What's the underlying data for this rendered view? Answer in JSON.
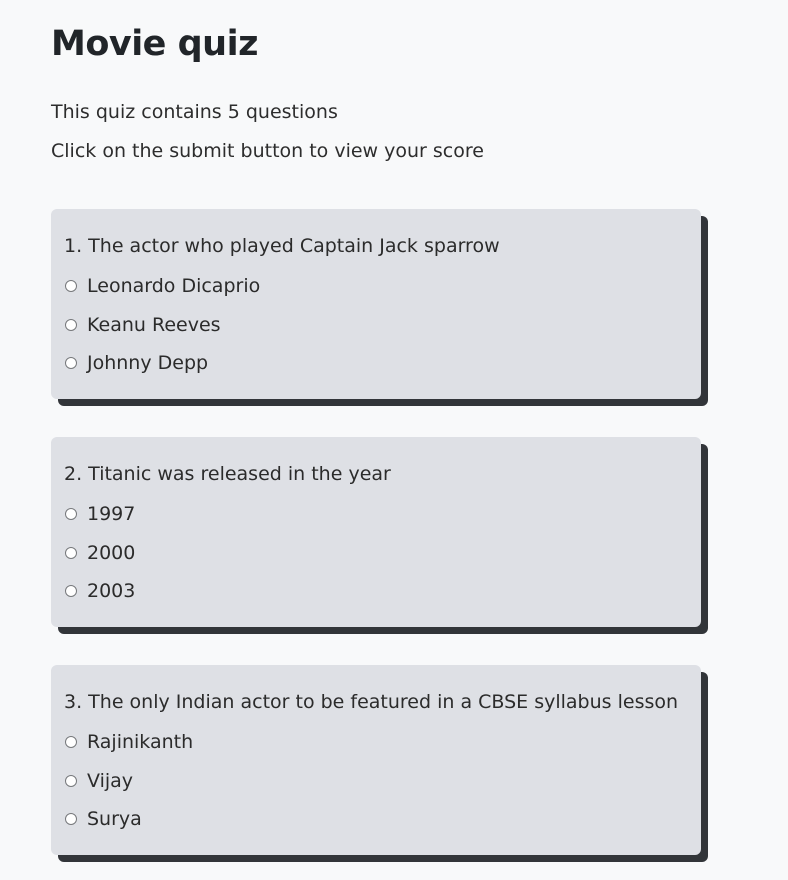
{
  "quiz": {
    "title": "Movie quiz",
    "intro_line_1": "This quiz contains 5 questions",
    "intro_line_2": "Click on the submit button to view your score",
    "questions": [
      {
        "text": "1. The actor who played Captain Jack sparrow",
        "options": [
          "Leonardo Dicaprio",
          "Keanu Reeves",
          "Johnny Depp"
        ],
        "selected": null
      },
      {
        "text": "2. Titanic was released in the year",
        "options": [
          "1997",
          "2000",
          "2003"
        ],
        "selected": null
      },
      {
        "text": "3. The only Indian actor to be featured in a CBSE syllabus lesson",
        "options": [
          "Rajinikanth",
          "Vijay",
          "Surya"
        ],
        "selected": null
      }
    ]
  },
  "colors": {
    "page_background": "#f8f9fa",
    "card_background": "#dee0e5",
    "card_shadow": "#323539",
    "text": "#2b2b2b",
    "radio_border": "#77797c"
  }
}
